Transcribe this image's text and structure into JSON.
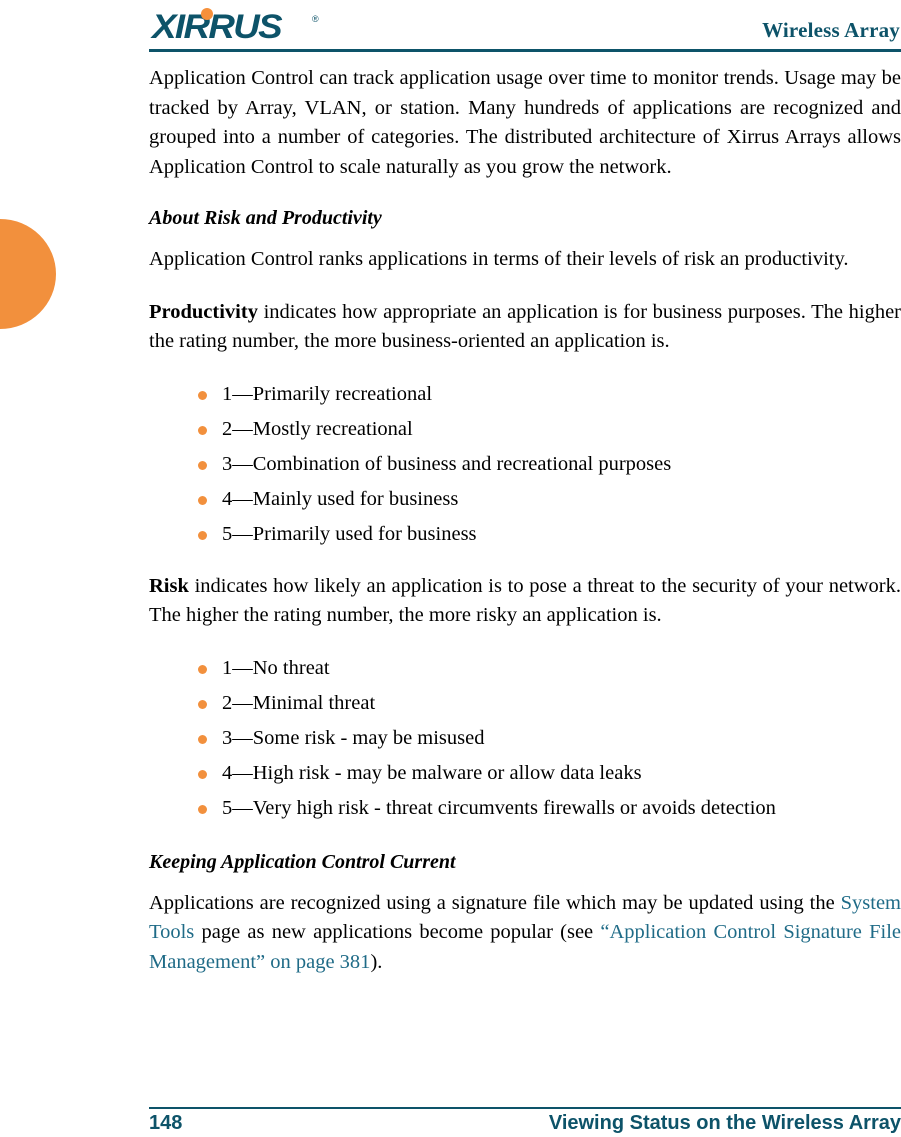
{
  "header": {
    "logo_text": "XIRRUS",
    "logo_tm": "®",
    "title": "Wireless Array"
  },
  "body": {
    "intro_paragraph": "Application Control can track application usage over time to monitor trends. Usage may be tracked by Array, VLAN, or station. Many hundreds of applications are recognized and grouped into a number of categories. The distributed architecture of Xirrus Arrays allows Application Control to scale naturally as you grow the network.",
    "section_risk_productivity": {
      "heading": "About Risk and Productivity",
      "paragraph": "Application Control ranks applications in terms of their levels of risk an productivity.",
      "productivity_label": "Productivity",
      "productivity_text": " indicates how appropriate an application is for business purposes. The higher the rating number, the more business-oriented an application is.",
      "productivity_levels": [
        "1—Primarily recreational",
        "2—Mostly recreational",
        "3—Combination of business and recreational purposes",
        "4—Mainly used for business",
        "5—Primarily used for business"
      ],
      "risk_label": "Risk",
      "risk_text": " indicates how likely an application is to pose a threat to the security of your network. The higher the rating number, the more risky an application is.",
      "risk_levels": [
        "1—No threat",
        "2—Minimal threat",
        "3—Some risk - may be misused",
        "4—High risk - may be malware or allow data leaks",
        "5—Very high risk - threat circumvents firewalls or avoids detection"
      ]
    },
    "section_keeping_current": {
      "heading": "Keeping Application Control Current",
      "text_part1": "Applications are recognized using a signature file which may be updated using the ",
      "link_system_tools": "System Tools",
      "text_part2": " page as new applications become popular (see ",
      "link_signature": "“Application Control Signature File Management” on page 381",
      "text_part3": ")."
    }
  },
  "footer": {
    "page_number": "148",
    "section_title": "Viewing Status on the Wireless Array"
  },
  "colors": {
    "brand_teal": "#0D5369",
    "brand_orange": "#F2903D",
    "link_blue": "#1F6B87"
  }
}
